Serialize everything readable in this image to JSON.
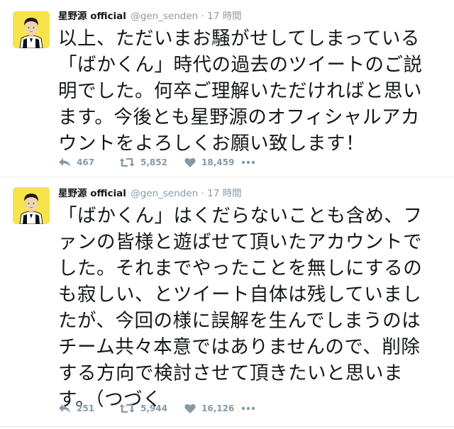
{
  "tweets": [
    {
      "fullname": "星野源 official",
      "username": "@gen_senden",
      "separator": "·",
      "timestamp": "17 時間",
      "text_lines": [
        "以上、ただいまお騒がせしてしまっている",
        "「ばかくん」時代の過去のツイートのご説",
        "明でした。何卒ご理解いただければと思い",
        "ます。今後とも星野源のオフィシャルアカ",
        "ウントをよろしくお願い致します！"
      ],
      "actions": {
        "reply_count": "467",
        "retweet_count": "5,852",
        "like_count": "18,459",
        "more_icon": "ellipsis-icon"
      }
    },
    {
      "fullname": "星野源 official",
      "username": "@gen_senden",
      "separator": "·",
      "timestamp": "17 時間",
      "text_lines": [
        "「ばかくん」はくだらないことも含め、フ",
        "ァンの皆様と遊ばせて頂いたアカウントで",
        "した。それまでやったことを無しにするの",
        "も寂しい、とツイート自体は残していまし",
        "たが、今回の様に誤解を生んでしまうのは",
        "チーム共々本意ではありませんので、削除",
        "する方向で検討させて頂きたいと思いま",
        "す。（つづく"
      ],
      "actions": {
        "reply_count": "251",
        "retweet_count": "5,944",
        "like_count": "16,126",
        "more_icon": "ellipsis-icon"
      }
    }
  ],
  "colors": {
    "avatar_bg": "#f7e34b",
    "muted": "#8899a6",
    "text": "#14171a",
    "divider": "#e6ecf0"
  },
  "icons": [
    "reply-icon",
    "retweet-icon",
    "heart-icon",
    "ellipsis-icon"
  ]
}
